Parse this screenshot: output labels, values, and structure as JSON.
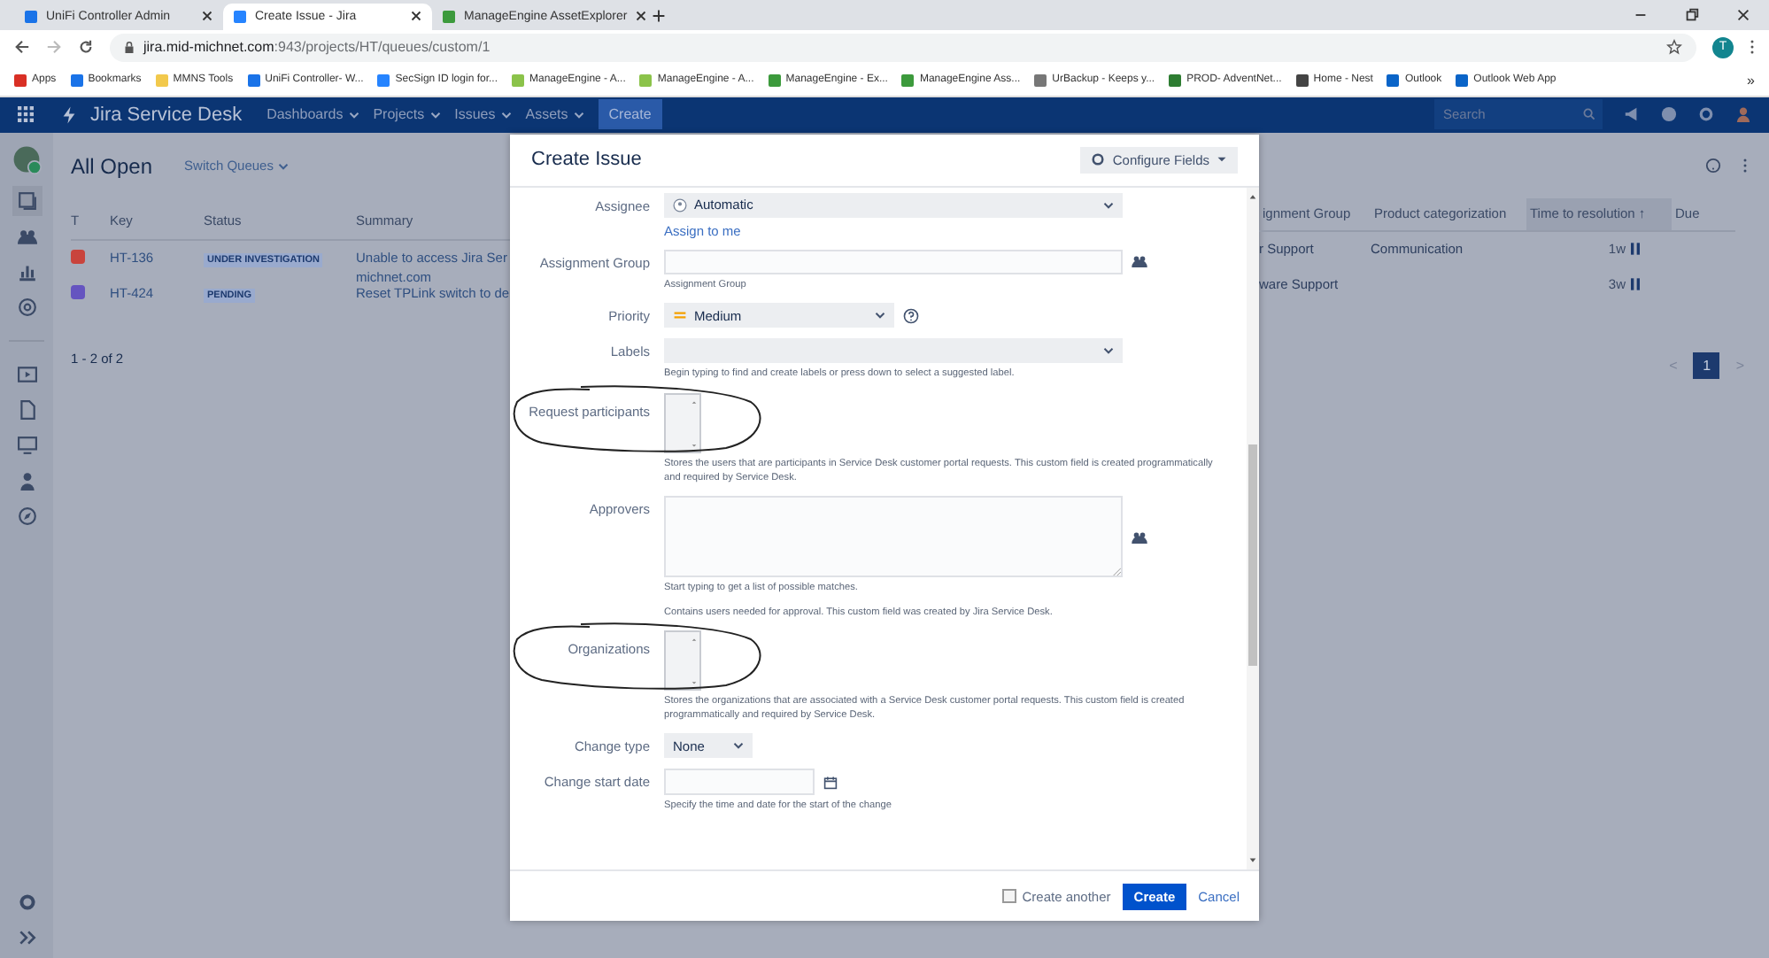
{
  "browser": {
    "tabs": [
      {
        "title": "UniFi Controller Admin",
        "color": "#1a73e8",
        "selected": false
      },
      {
        "title": "Create Issue - Jira",
        "color": "#2684ff",
        "selected": true
      },
      {
        "title": "ManageEngine AssetExplorer",
        "color": "#3c9a3c",
        "selected": false
      }
    ],
    "url_host": "jira.mid-michnet.com",
    "url_path": ":943/projects/HT/queues/custom/1",
    "profile": "T",
    "bookmarks": [
      {
        "title": "Apps",
        "color": "#d93025"
      },
      {
        "title": "Bookmarks",
        "color": "#1a73e8"
      },
      {
        "title": "MMNS Tools",
        "color": "#f2c94c"
      },
      {
        "title": "UniFi Controller- W...",
        "color": "#1a73e8"
      },
      {
        "title": "SecSign ID login for...",
        "color": "#2684ff"
      },
      {
        "title": "ManageEngine - A...",
        "color": "#8bc34a"
      },
      {
        "title": "ManageEngine - A...",
        "color": "#8bc34a"
      },
      {
        "title": "ManageEngine - Ex...",
        "color": "#3c9a3c"
      },
      {
        "title": "ManageEngine Ass...",
        "color": "#3c9a3c"
      },
      {
        "title": "UrBackup - Keeps y...",
        "color": "#777777"
      },
      {
        "title": "PROD- AdventNet...",
        "color": "#2e7d32"
      },
      {
        "title": "Home - Nest",
        "color": "#444444"
      },
      {
        "title": "Outlook",
        "color": "#0a64c8"
      },
      {
        "title": "Outlook Web App",
        "color": "#0a64c8"
      }
    ],
    "more": "»"
  },
  "jira": {
    "product": "Jira Service Desk",
    "nav": [
      "Dashboards",
      "Projects",
      "Issues",
      "Assets"
    ],
    "create": "Create",
    "search_placeholder": "Search"
  },
  "queue": {
    "title": "All Open",
    "switch": "Switch Queues",
    "columns_left": [
      "T",
      "Key",
      "Status",
      "Summary"
    ],
    "rows_left": [
      {
        "color": "#c9443d",
        "key": "HT-136",
        "status": "UNDER INVESTIGATION",
        "summary": [
          "Unable to access Jira Ser",
          "michnet.com"
        ]
      },
      {
        "color": "#6554c0",
        "key": "HT-424",
        "status": "PENDING",
        "summary": [
          "Reset TPLink switch to de"
        ]
      }
    ],
    "count": "1 - 2 of 2",
    "columns_right": [
      {
        "label": "ignment Group",
        "selected": false
      },
      {
        "label": "Product categorization",
        "selected": false
      },
      {
        "label": "Time to resolution ↑",
        "selected": true
      },
      {
        "label": "Due",
        "selected": false
      }
    ],
    "rows_right": [
      {
        "column_1": "r Support",
        "column_2": "Communication",
        "time": "1w"
      },
      {
        "column_1": "ware Support",
        "time": "3w"
      }
    ],
    "pages": [
      {
        "label": "1",
        "selected": true
      }
    ],
    "prev": "<",
    "next": ">"
  },
  "dialog": {
    "title": "Create Issue",
    "configure": "Configure Fields",
    "fields": [
      {
        "kind": "user-select",
        "label": "Assignee",
        "value": "Automatic",
        "link": "Assign to me"
      },
      {
        "kind": "group",
        "label": "Assignment Group",
        "hints": [
          "Assignment Group"
        ]
      },
      {
        "kind": "priority",
        "label": "Priority",
        "value": "Medium"
      },
      {
        "kind": "select",
        "label": "Labels",
        "hints": [
          "Begin typing to find and create labels or press down to select a suggested label."
        ]
      },
      {
        "kind": "listbox",
        "label": "Request participants",
        "hints": [
          "Stores the users that are participants in Service Desk customer portal requests. This custom field is created programmatically and required by Service Desk."
        ]
      },
      {
        "kind": "textarea",
        "label": "Approvers",
        "hints": [
          "Start typing to get a list of possible matches.",
          "Contains users needed for approval. This custom field was created by Jira Service Desk."
        ]
      },
      {
        "kind": "listbox",
        "label": "Organizations",
        "hints": [
          "Stores the organizations that are associated with a Service Desk customer portal requests. This custom field is created programmatically and required by Service Desk."
        ]
      },
      {
        "kind": "small-select",
        "label": "Change type",
        "value": "None"
      },
      {
        "kind": "date",
        "label": "Change start date",
        "hints": [
          "Specify the time and date for the start of the change"
        ]
      }
    ],
    "create_another": {
      "label": "Create another",
      "checked": false
    },
    "create": "Create",
    "cancel": "Cancel"
  }
}
